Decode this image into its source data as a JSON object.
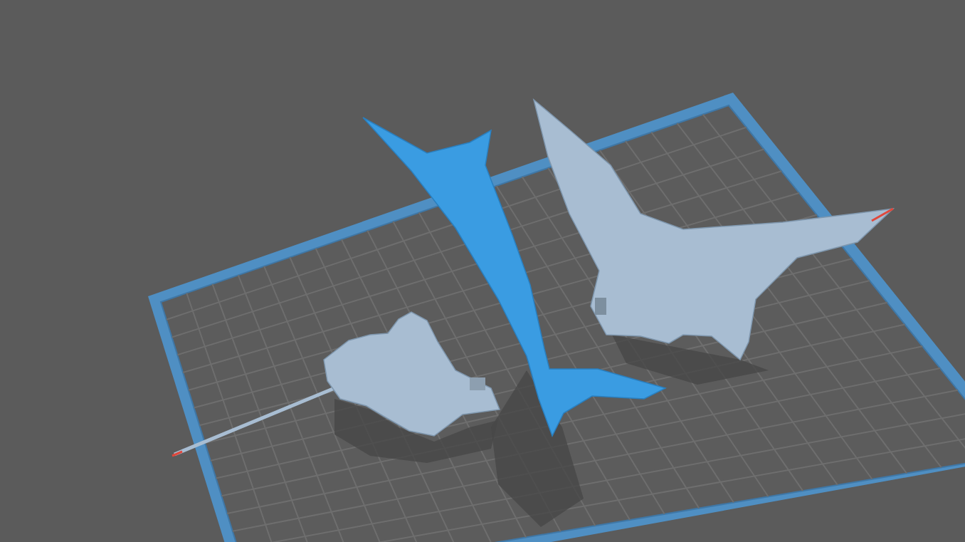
{
  "viewport": {
    "view": "perspective"
  },
  "models": [
    {
      "kind": "dragon-body",
      "selected": false
    },
    {
      "kind": "wing",
      "selected": true
    },
    {
      "kind": "wing-tail",
      "selected": false
    }
  ]
}
